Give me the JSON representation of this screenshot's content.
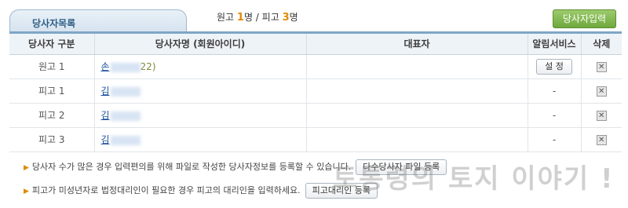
{
  "header": {
    "tab_title": "당사자목록",
    "counts": {
      "plaintiff_label": "원고 ",
      "plaintiff_count": "1",
      "plaintiff_unit": "명 / ",
      "defendant_label": "피고 ",
      "defendant_count": "3",
      "defendant_unit": "명"
    },
    "add_button": "당사자입력"
  },
  "table": {
    "columns": [
      "당사자 구분",
      "당사자명 (회원아이디)",
      "대표자",
      "알림서비스",
      "삭제"
    ],
    "rows": [
      {
        "type": "원고 1",
        "name_prefix": "손",
        "name_suffix": "22)",
        "rep": "",
        "alert": "설 정",
        "alert_is_button": true
      },
      {
        "type": "피고 1",
        "name_prefix": "김",
        "name_suffix": "",
        "rep": "",
        "alert": "-",
        "alert_is_button": false
      },
      {
        "type": "피고 2",
        "name_prefix": "김",
        "name_suffix": "",
        "rep": "",
        "alert": "-",
        "alert_is_button": false
      },
      {
        "type": "피고 3",
        "name_prefix": "김",
        "name_suffix": "",
        "rep": "",
        "alert": "-",
        "alert_is_button": false
      }
    ],
    "delete_icon": "close-box-icon"
  },
  "notes": {
    "note1": {
      "text": "당사자 수가 많은 경우 입력편의를 위해 파일로 작성한 당사자정보를 등록할 수 있습니다.",
      "button": "다수당사자 파일 등록"
    },
    "note2": {
      "text": "피고가 미성년자로 법정대리인이 필요한 경우 피고의 대리인을 입력하세요.",
      "button": "피고대리인 등록"
    }
  },
  "watermark": "토통령의 토지 이야기 !",
  "colors": {
    "accent": "#e08a00",
    "header_blue": "#7fa6c6",
    "add_button_green": "#7bb24a",
    "link": "#1d4f9e"
  }
}
